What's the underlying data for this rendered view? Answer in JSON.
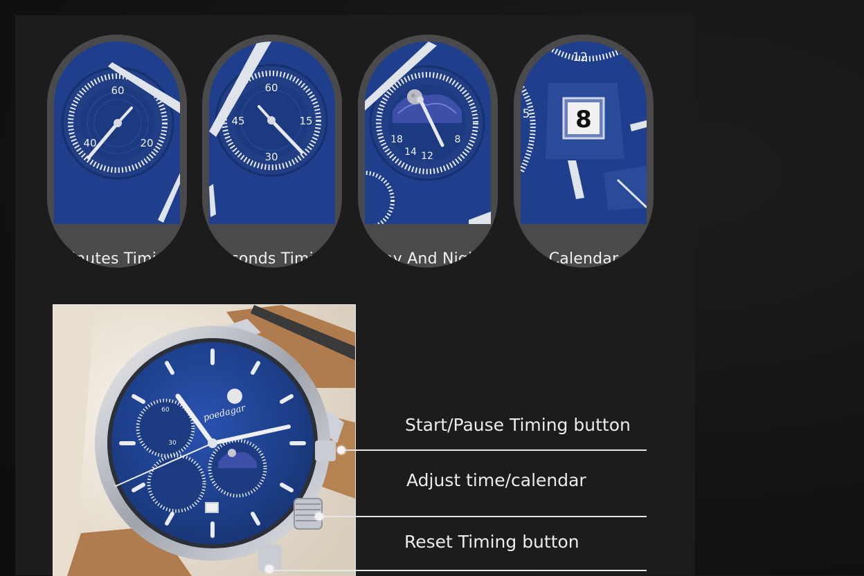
{
  "features": [
    {
      "label": "Minutes Timing",
      "dial_numbers": [
        "60",
        "40",
        "20"
      ]
    },
    {
      "label": "Seconds Timing",
      "dial_numbers": [
        "60",
        "45",
        "15",
        "30"
      ]
    },
    {
      "label": "Day And Night",
      "dial_numbers": [
        "18",
        "14",
        "12",
        "8"
      ]
    },
    {
      "label": "Calendar",
      "dial_numbers": [
        "12",
        "5",
        "8"
      ]
    }
  ],
  "product": {
    "brand_wordmark": "poedagar",
    "dial_numbers": [
      "60",
      "30"
    ]
  },
  "callouts": [
    {
      "label": "Start/Pause Timing button"
    },
    {
      "label": "Adjust time/calendar"
    },
    {
      "label": "Reset Timing button"
    }
  ],
  "colors": {
    "dial_blue": "#1f3f8c",
    "card_gray": "#4a4a4c",
    "panel_bg": "#1c1c1d",
    "steel": "#c9ccd2",
    "leather": "#b07b4d"
  }
}
